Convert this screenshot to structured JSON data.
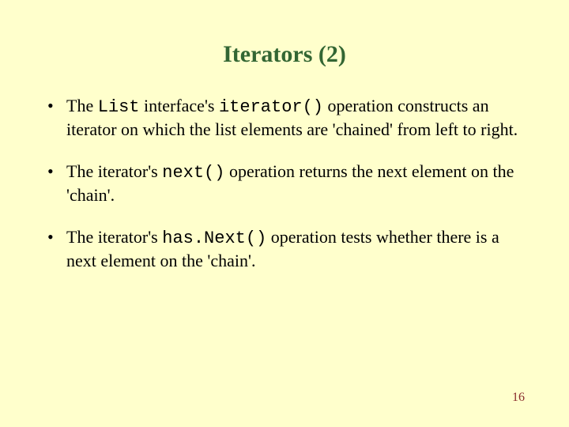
{
  "title": "Iterators (2)",
  "bullets": [
    {
      "pre1": "The ",
      "code1": "List",
      "mid1": " interface's ",
      "code2": "iterator()",
      "post1": " operation constructs an iterator on which the list elements are 'chained' from left to right."
    },
    {
      "pre1": "The iterator's ",
      "code1": "next()",
      "post1": " operation returns the next element on the 'chain'."
    },
    {
      "pre1": "The iterator's ",
      "code1": "has.Next()",
      "post1": " operation tests whether there is a next element on the 'chain'."
    }
  ],
  "page_number": "16",
  "dot": "•"
}
